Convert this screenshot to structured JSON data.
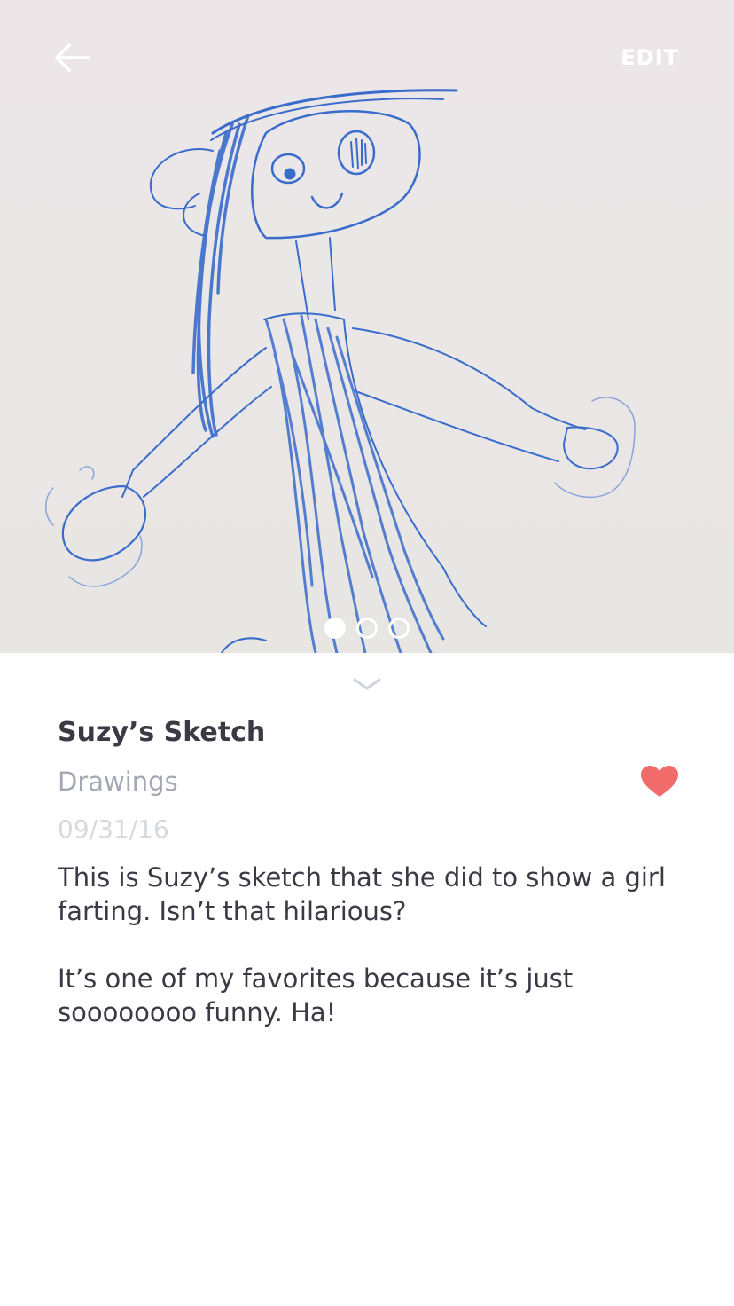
{
  "header": {
    "back_icon": "arrow-left-icon",
    "edit_label": "EDIT"
  },
  "gallery": {
    "image_subject": "child's crayon drawing",
    "page_count": 3,
    "active_page": 1
  },
  "detail": {
    "title": "Suzy’s Sketch",
    "category": "Drawings",
    "date": "09/31/16",
    "favorite": true,
    "favorite_icon": "heart-icon",
    "expand_icon": "chevron-down-icon",
    "description": [
      "This is Suzy’s sketch that she did to show a girl farting. Isn’t that hilarious?",
      "It’s one of my favorites because it’s just soooooooo funny. Ha!"
    ]
  },
  "colors": {
    "heart": "#f26b6b",
    "title": "#3a3a44",
    "category": "#a3a8b3",
    "date": "#d6d9de",
    "crayon": "#2f62c4"
  }
}
